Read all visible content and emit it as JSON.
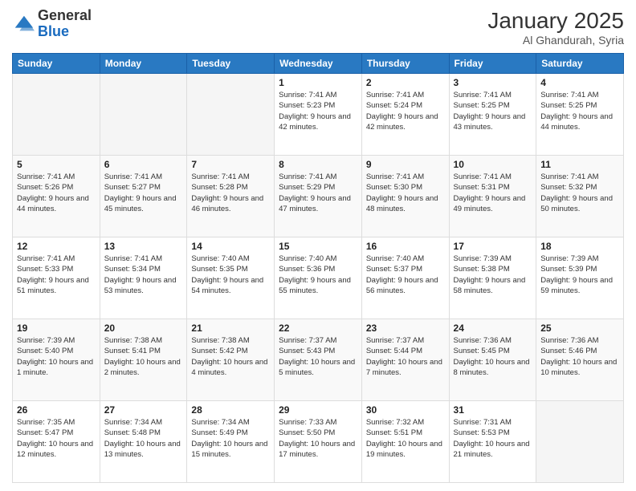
{
  "logo": {
    "general": "General",
    "blue": "Blue"
  },
  "title": "January 2025",
  "subtitle": "Al Ghandurah, Syria",
  "weekdays": [
    "Sunday",
    "Monday",
    "Tuesday",
    "Wednesday",
    "Thursday",
    "Friday",
    "Saturday"
  ],
  "weeks": [
    [
      {
        "day": null,
        "info": null
      },
      {
        "day": null,
        "info": null
      },
      {
        "day": null,
        "info": null
      },
      {
        "day": "1",
        "info": "Sunrise: 7:41 AM\nSunset: 5:23 PM\nDaylight: 9 hours and 42 minutes."
      },
      {
        "day": "2",
        "info": "Sunrise: 7:41 AM\nSunset: 5:24 PM\nDaylight: 9 hours and 42 minutes."
      },
      {
        "day": "3",
        "info": "Sunrise: 7:41 AM\nSunset: 5:25 PM\nDaylight: 9 hours and 43 minutes."
      },
      {
        "day": "4",
        "info": "Sunrise: 7:41 AM\nSunset: 5:25 PM\nDaylight: 9 hours and 44 minutes."
      }
    ],
    [
      {
        "day": "5",
        "info": "Sunrise: 7:41 AM\nSunset: 5:26 PM\nDaylight: 9 hours and 44 minutes."
      },
      {
        "day": "6",
        "info": "Sunrise: 7:41 AM\nSunset: 5:27 PM\nDaylight: 9 hours and 45 minutes."
      },
      {
        "day": "7",
        "info": "Sunrise: 7:41 AM\nSunset: 5:28 PM\nDaylight: 9 hours and 46 minutes."
      },
      {
        "day": "8",
        "info": "Sunrise: 7:41 AM\nSunset: 5:29 PM\nDaylight: 9 hours and 47 minutes."
      },
      {
        "day": "9",
        "info": "Sunrise: 7:41 AM\nSunset: 5:30 PM\nDaylight: 9 hours and 48 minutes."
      },
      {
        "day": "10",
        "info": "Sunrise: 7:41 AM\nSunset: 5:31 PM\nDaylight: 9 hours and 49 minutes."
      },
      {
        "day": "11",
        "info": "Sunrise: 7:41 AM\nSunset: 5:32 PM\nDaylight: 9 hours and 50 minutes."
      }
    ],
    [
      {
        "day": "12",
        "info": "Sunrise: 7:41 AM\nSunset: 5:33 PM\nDaylight: 9 hours and 51 minutes."
      },
      {
        "day": "13",
        "info": "Sunrise: 7:41 AM\nSunset: 5:34 PM\nDaylight: 9 hours and 53 minutes."
      },
      {
        "day": "14",
        "info": "Sunrise: 7:40 AM\nSunset: 5:35 PM\nDaylight: 9 hours and 54 minutes."
      },
      {
        "day": "15",
        "info": "Sunrise: 7:40 AM\nSunset: 5:36 PM\nDaylight: 9 hours and 55 minutes."
      },
      {
        "day": "16",
        "info": "Sunrise: 7:40 AM\nSunset: 5:37 PM\nDaylight: 9 hours and 56 minutes."
      },
      {
        "day": "17",
        "info": "Sunrise: 7:39 AM\nSunset: 5:38 PM\nDaylight: 9 hours and 58 minutes."
      },
      {
        "day": "18",
        "info": "Sunrise: 7:39 AM\nSunset: 5:39 PM\nDaylight: 9 hours and 59 minutes."
      }
    ],
    [
      {
        "day": "19",
        "info": "Sunrise: 7:39 AM\nSunset: 5:40 PM\nDaylight: 10 hours and 1 minute."
      },
      {
        "day": "20",
        "info": "Sunrise: 7:38 AM\nSunset: 5:41 PM\nDaylight: 10 hours and 2 minutes."
      },
      {
        "day": "21",
        "info": "Sunrise: 7:38 AM\nSunset: 5:42 PM\nDaylight: 10 hours and 4 minutes."
      },
      {
        "day": "22",
        "info": "Sunrise: 7:37 AM\nSunset: 5:43 PM\nDaylight: 10 hours and 5 minutes."
      },
      {
        "day": "23",
        "info": "Sunrise: 7:37 AM\nSunset: 5:44 PM\nDaylight: 10 hours and 7 minutes."
      },
      {
        "day": "24",
        "info": "Sunrise: 7:36 AM\nSunset: 5:45 PM\nDaylight: 10 hours and 8 minutes."
      },
      {
        "day": "25",
        "info": "Sunrise: 7:36 AM\nSunset: 5:46 PM\nDaylight: 10 hours and 10 minutes."
      }
    ],
    [
      {
        "day": "26",
        "info": "Sunrise: 7:35 AM\nSunset: 5:47 PM\nDaylight: 10 hours and 12 minutes."
      },
      {
        "day": "27",
        "info": "Sunrise: 7:34 AM\nSunset: 5:48 PM\nDaylight: 10 hours and 13 minutes."
      },
      {
        "day": "28",
        "info": "Sunrise: 7:34 AM\nSunset: 5:49 PM\nDaylight: 10 hours and 15 minutes."
      },
      {
        "day": "29",
        "info": "Sunrise: 7:33 AM\nSunset: 5:50 PM\nDaylight: 10 hours and 17 minutes."
      },
      {
        "day": "30",
        "info": "Sunrise: 7:32 AM\nSunset: 5:51 PM\nDaylight: 10 hours and 19 minutes."
      },
      {
        "day": "31",
        "info": "Sunrise: 7:31 AM\nSunset: 5:53 PM\nDaylight: 10 hours and 21 minutes."
      },
      {
        "day": null,
        "info": null
      }
    ]
  ]
}
